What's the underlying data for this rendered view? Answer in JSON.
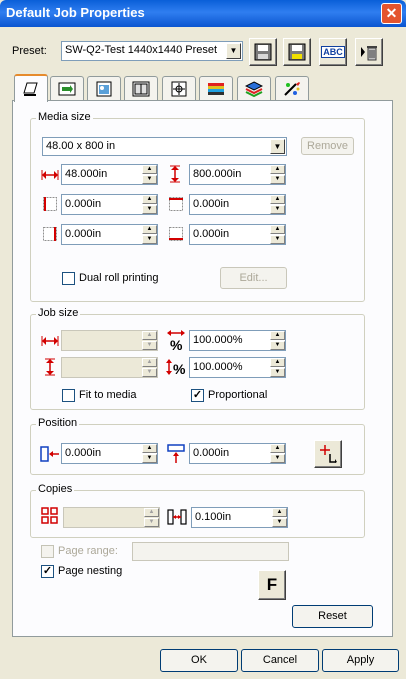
{
  "window": {
    "title": "Default Job Properties",
    "close_glyph": "✕"
  },
  "preset": {
    "label": "Preset:",
    "value": "SW-Q2-Test 1440x1440 Preset",
    "toolbar_icons": [
      "save-icon",
      "save-as-icon",
      "rename-icon",
      "delete-icon"
    ],
    "rename_text": "ABC"
  },
  "tabs": [
    {
      "icon": "page-setup-icon"
    },
    {
      "icon": "color-icon"
    },
    {
      "icon": "image-icon"
    },
    {
      "icon": "layout-icon"
    },
    {
      "icon": "marks-icon"
    },
    {
      "icon": "color-bars-icon"
    },
    {
      "icon": "layers-icon"
    },
    {
      "icon": "effects-icon"
    }
  ],
  "media_size": {
    "title": "Media size",
    "selected": "48.00 x 800 in",
    "remove_label": "Remove",
    "width": "48.000in",
    "height": "800.000in",
    "margin_left": "0.000in",
    "margin_top": "0.000in",
    "margin_right": "0.000in",
    "margin_bottom": "0.000in",
    "dual_roll_label": "Dual roll printing",
    "edit_label": "Edit..."
  },
  "job_size": {
    "title": "Job size",
    "width": "",
    "height": "",
    "scale_width": "100.000%",
    "scale_height": "100.000%",
    "fit_to_media_label": "Fit to media",
    "proportional_label": "Proportional",
    "proportional_checked": true
  },
  "position": {
    "title": "Position",
    "x": "0.000in",
    "y": "0.000in"
  },
  "copies": {
    "title": "Copies",
    "count": "",
    "gap": "0.100in"
  },
  "page_range": {
    "label": "Page range:",
    "value": ""
  },
  "page_nesting": {
    "label": "Page nesting",
    "checked": true
  },
  "font_button": "F",
  "reset_label": "Reset",
  "footer": {
    "ok": "OK",
    "cancel": "Cancel",
    "apply": "Apply"
  },
  "colors": {
    "title_bar": "#0a5fd8",
    "close": "#e4542e",
    "dialog_bg": "#ece9d8",
    "tab_accent": "#e68b2c",
    "arrow_red": "#d20000"
  }
}
